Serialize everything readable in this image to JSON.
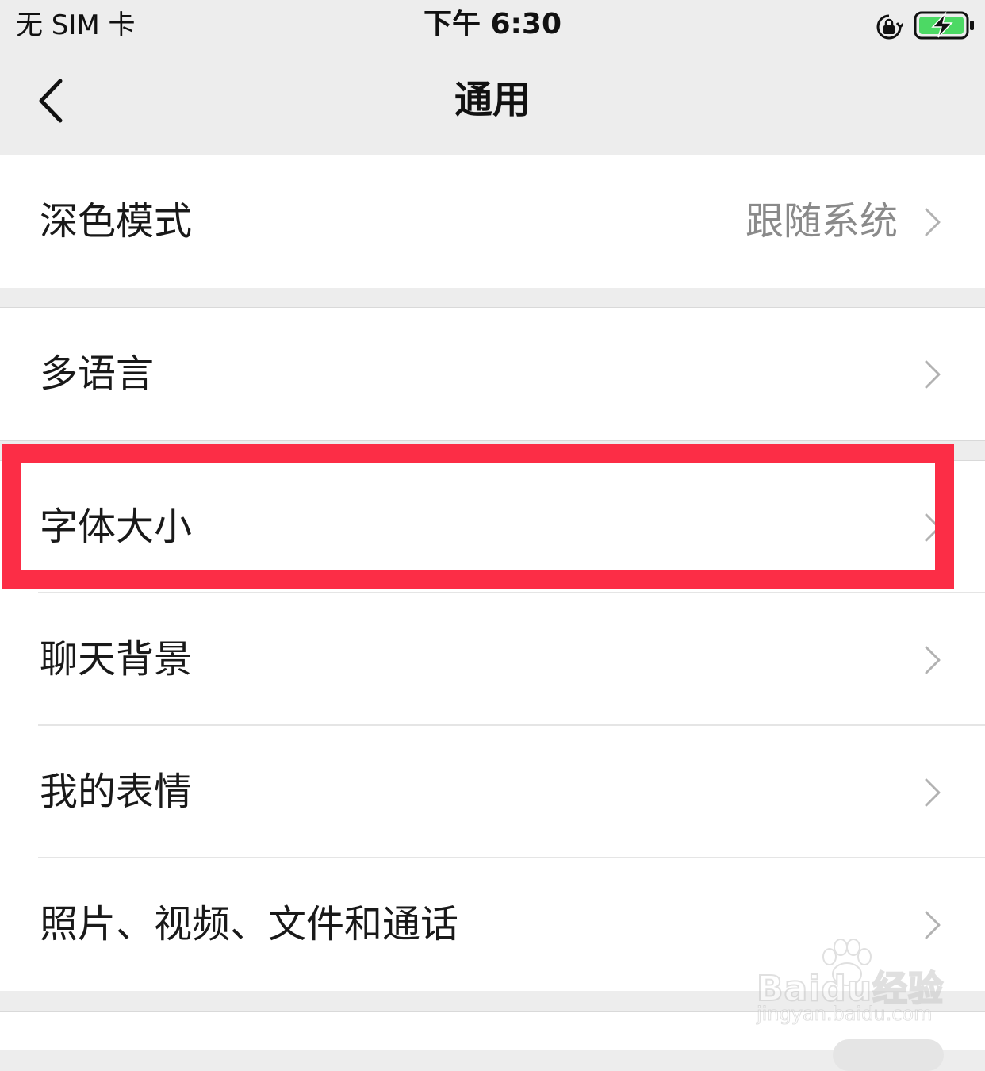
{
  "status_bar": {
    "carrier": "无 SIM 卡",
    "time": "下午 6:30",
    "icons": [
      "orientation-lock-icon",
      "battery-charging-icon"
    ],
    "battery_color": "#4cd964"
  },
  "nav": {
    "title": "通用",
    "back_icon": "chevron-left-icon"
  },
  "settings": {
    "dark_mode": {
      "label": "深色模式",
      "value": "跟随系统"
    },
    "language": {
      "label": "多语言"
    },
    "font_size": {
      "label": "字体大小"
    },
    "chat_background": {
      "label": "聊天背景"
    },
    "my_stickers": {
      "label": "我的表情"
    },
    "media": {
      "label": "照片、视频、文件和通话"
    }
  },
  "highlight": {
    "target": "font_size",
    "color": "#fc2d46"
  },
  "watermark": {
    "logo": "Baidu经验",
    "url": "jingyan.baidu.com"
  },
  "colors": {
    "background": "#ededed",
    "cell": "#ffffff",
    "text": "#191919",
    "secondary_text": "#8a8a8a"
  }
}
